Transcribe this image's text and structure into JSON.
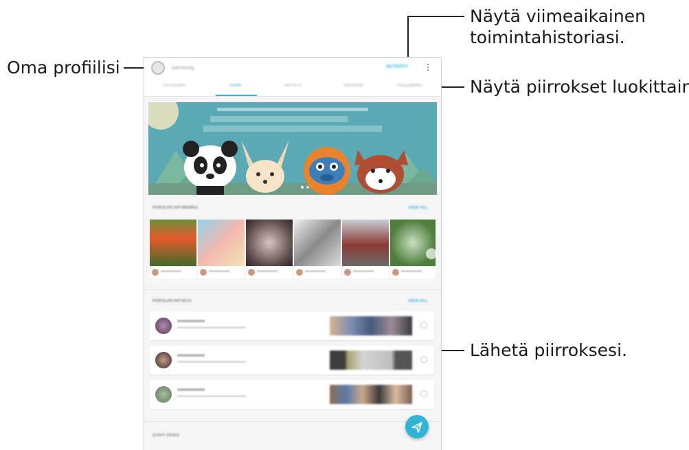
{
  "callouts": {
    "profile": "Oma profiilisi",
    "activity_line1": "Näytä viimeaikainen",
    "activity_line2": "toimintahistoriasi.",
    "categories": "Näytä piirrokset luokittain.",
    "upload": "Lähetä piirroksesi."
  },
  "colors": {
    "accent": "#30b4d6",
    "banner_bg": "#5aaab5",
    "card_bg": "#ffffff",
    "app_bg": "#f5f5f5"
  },
  "icons": {
    "profile": "avatar-icon",
    "menu": "more-vert-icon",
    "fab": "paper-plane-icon",
    "link": "link-icon"
  }
}
